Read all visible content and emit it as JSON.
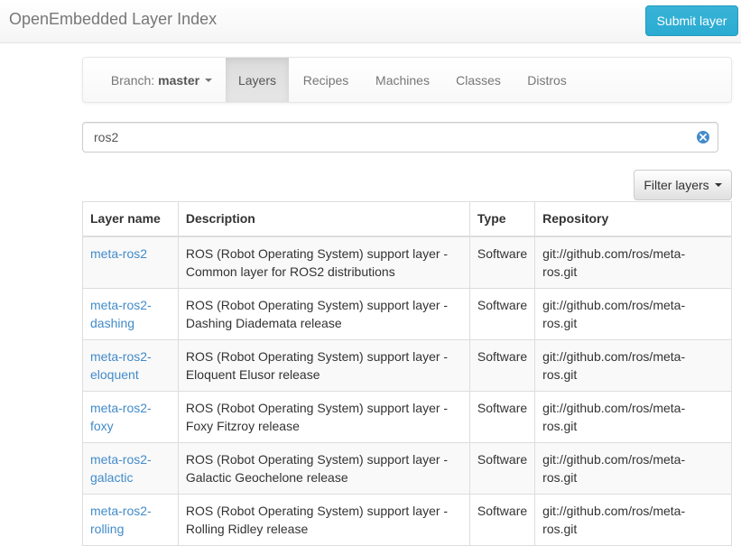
{
  "app": {
    "brand": "OpenEmbedded Layer Index",
    "submit_label": "Submit layer"
  },
  "nav": {
    "branch_prefix": "Branch:",
    "branch_value": "master",
    "tabs": [
      {
        "label": "Layers",
        "active": true
      },
      {
        "label": "Recipes",
        "active": false
      },
      {
        "label": "Machines",
        "active": false
      },
      {
        "label": "Classes",
        "active": false
      },
      {
        "label": "Distros",
        "active": false
      }
    ]
  },
  "search": {
    "value": "ros2"
  },
  "filter": {
    "label": "Filter layers"
  },
  "table": {
    "headers": [
      "Layer name",
      "Description",
      "Type",
      "Repository"
    ],
    "rows": [
      {
        "name_1": "meta-ros2",
        "name_2": "",
        "desc_1": "ROS (Robot Operating System) support layer -",
        "desc_2": "Common layer for ROS2 distributions",
        "type": "Software",
        "repo_1": "git://github.com/ros/meta-",
        "repo_2": "ros.git"
      },
      {
        "name_1": "meta-ros2-",
        "name_2": "dashing",
        "desc_1": "ROS (Robot Operating System) support layer -",
        "desc_2": "Dashing Diademata release",
        "type": "Software",
        "repo_1": "git://github.com/ros/meta-",
        "repo_2": "ros.git"
      },
      {
        "name_1": "meta-ros2-",
        "name_2": "eloquent",
        "desc_1": "ROS (Robot Operating System) support layer -",
        "desc_2": "Eloquent Elusor release",
        "type": "Software",
        "repo_1": "git://github.com/ros/meta-",
        "repo_2": "ros.git"
      },
      {
        "name_1": "meta-ros2-",
        "name_2": "foxy",
        "desc_1": "ROS (Robot Operating System) support layer -",
        "desc_2": "Foxy Fitzroy release",
        "type": "Software",
        "repo_1": "git://github.com/ros/meta-",
        "repo_2": "ros.git"
      },
      {
        "name_1": "meta-ros2-",
        "name_2": "galactic",
        "desc_1": "ROS (Robot Operating System) support layer -",
        "desc_2": "Galactic Geochelone release",
        "type": "Software",
        "repo_1": "git://github.com/ros/meta-",
        "repo_2": "ros.git"
      },
      {
        "name_1": "meta-ros2-",
        "name_2": "rolling",
        "desc_1": "ROS (Robot Operating System) support layer -",
        "desc_2": "Rolling Ridley release",
        "type": "Software",
        "repo_1": "git://github.com/ros/meta-",
        "repo_2": "ros.git"
      }
    ]
  },
  "colors": {
    "link": "#428bca",
    "primary_button": "#39b3d7"
  }
}
